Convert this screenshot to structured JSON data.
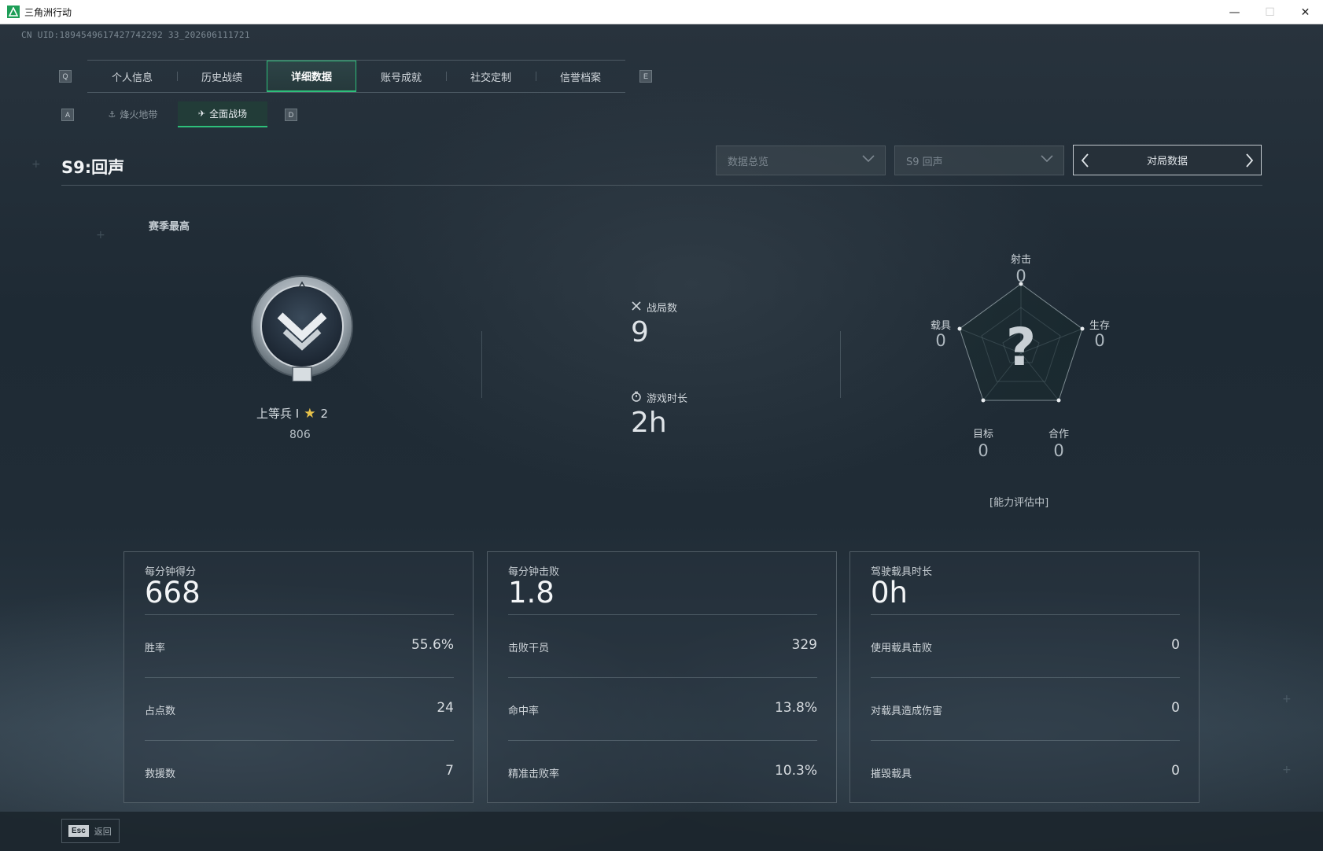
{
  "window": {
    "title": "三角洲行动",
    "controls": {
      "minimize": "—",
      "maximize": "☐",
      "close": "✕"
    }
  },
  "header": {
    "uid": "CN UID:1894549617427742292 33_202606111721"
  },
  "tabs": {
    "prev_key": "Q",
    "next_key": "E",
    "items": [
      {
        "label": "个人信息",
        "active": false
      },
      {
        "label": "历史战绩",
        "active": false
      },
      {
        "label": "详细数据",
        "active": true
      },
      {
        "label": "账号成就",
        "active": false
      },
      {
        "label": "社交定制",
        "active": false
      },
      {
        "label": "信誉档案",
        "active": false
      }
    ]
  },
  "subtabs": {
    "prev_key": "A",
    "next_key": "D",
    "items": [
      {
        "label": "烽火地带",
        "icon": "hazard-zone-icon",
        "active": false
      },
      {
        "label": "全面战场",
        "icon": "battlefield-icon",
        "active": true
      }
    ]
  },
  "season": {
    "title": "S9:回声"
  },
  "filters": {
    "overview": "数据总览",
    "season_select": "S9 回声",
    "pager_label": "对局数据"
  },
  "rank": {
    "section_label": "赛季最高",
    "name": "上等兵 I",
    "stars": "2",
    "score": "806",
    "emblem_tier": "I"
  },
  "summary": {
    "matches_label": "战局数",
    "matches_value": "9",
    "playtime_label": "游戏时长",
    "playtime_value": "2h"
  },
  "radar": {
    "center_mark": "?",
    "axes": [
      {
        "label": "射击",
        "value": "0"
      },
      {
        "label": "生存",
        "value": "0"
      },
      {
        "label": "合作",
        "value": "0"
      },
      {
        "label": "目标",
        "value": "0"
      },
      {
        "label": "载具",
        "value": "0"
      }
    ],
    "note": "[能力评估中]"
  },
  "cards": [
    {
      "head_label": "每分钟得分",
      "head_value": "668",
      "rows": [
        {
          "label": "胜率",
          "value": "55.6%"
        },
        {
          "label": "占点数",
          "value": "24"
        },
        {
          "label": "救援数",
          "value": "7"
        }
      ]
    },
    {
      "head_label": "每分钟击败",
      "head_value": "1.8",
      "rows": [
        {
          "label": "击败干员",
          "value": "329"
        },
        {
          "label": "命中率",
          "value": "13.8%"
        },
        {
          "label": "精准击败率",
          "value": "10.3%"
        }
      ]
    },
    {
      "head_label": "驾驶载具时长",
      "head_value": "0h",
      "rows": [
        {
          "label": "使用载具击败",
          "value": "0"
        },
        {
          "label": "对载具造成伤害",
          "value": "0"
        },
        {
          "label": "摧毁载具",
          "value": "0"
        }
      ]
    }
  ],
  "footer": {
    "esc_key": "Esc",
    "esc_label": "返回"
  },
  "colors": {
    "accent": "#2dbf7a",
    "star": "#e7c24a",
    "background": "#1e2a34"
  }
}
